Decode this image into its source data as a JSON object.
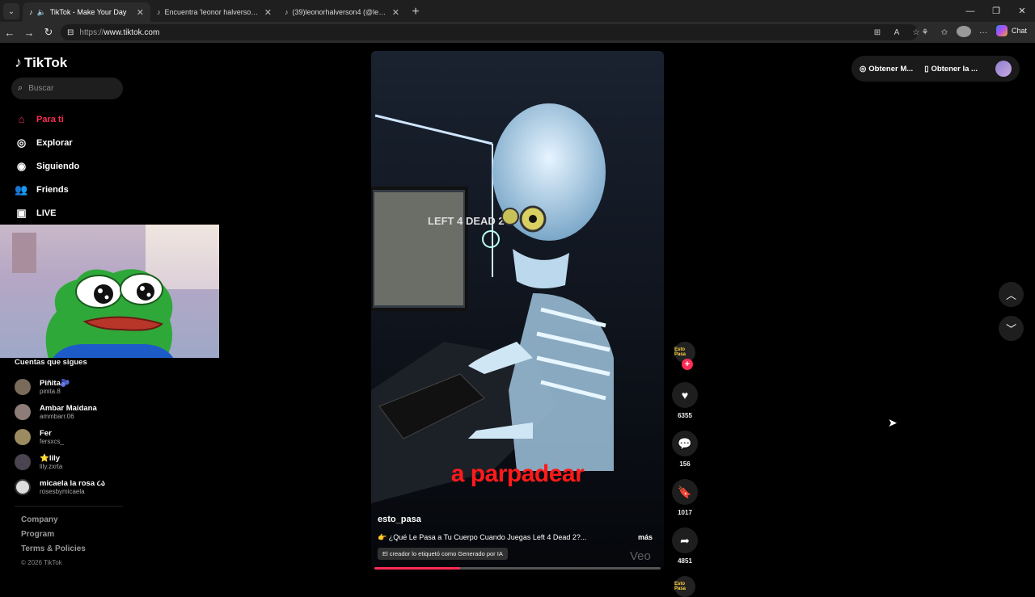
{
  "browser": {
    "tabs": [
      {
        "title": "TikTok - Make Your Day",
        "active": true
      },
      {
        "title": "Encuentra 'leonor halverson' en TikTok",
        "active": false
      },
      {
        "title": "(39)leonorhalverson4 (@leonorhalverson4)",
        "active": false
      }
    ],
    "url_scheme": "https://",
    "url_host": "www.tiktok.com",
    "chat_label": "Chat"
  },
  "sidebar": {
    "logo": "TikTok",
    "search_placeholder": "Buscar",
    "nav": [
      {
        "label": "Para ti",
        "icon": "home-icon",
        "active": true
      },
      {
        "label": "Explorar",
        "icon": "compass-icon"
      },
      {
        "label": "Siguiendo",
        "icon": "avatar-icon"
      },
      {
        "label": "Friends",
        "icon": "friends-icon"
      },
      {
        "label": "LIVE",
        "icon": "live-icon"
      }
    ],
    "following_title": "Cuentas que sigues",
    "following": [
      {
        "name": "Piñita🫐",
        "handle": "pinita.8"
      },
      {
        "name": "Ambar Maidana",
        "handle": "ammbarr.06"
      },
      {
        "name": "Fer",
        "handle": "fersxcs_"
      },
      {
        "name": "⭐lily",
        "handle": "lily.zxrta"
      },
      {
        "name": "micaela la rosa ૮ა",
        "handle": "rosesbymicaela"
      }
    ],
    "footer": [
      "Company",
      "Program",
      "Terms & Policies"
    ],
    "copyright": "© 2026 TikTok"
  },
  "video": {
    "overlay_text": "a parpadear",
    "author": "esto_pasa",
    "caption": "👉 ¿Qué Le Pasa a Tu Cuerpo Cuando Juegas Left 4 Dead 2?...",
    "more": "más",
    "ai_label": "El creador lo etiquetó como Generado por IA",
    "watermark": "Veo",
    "progress": 0.3
  },
  "actions": {
    "creator_avatar_text": "Esto Pasa",
    "likes": "6355",
    "comments": "156",
    "saves": "1017",
    "shares": "4851"
  },
  "topright": {
    "item1": "Obtener M...",
    "item2": "Obtener la ..."
  }
}
